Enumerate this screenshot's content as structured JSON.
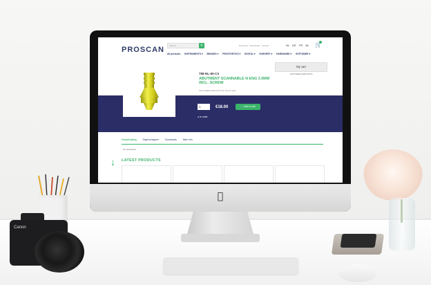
{
  "site": {
    "logo": "PROSCAN",
    "search_placeholder": "Search...",
    "top_links": "Prosceed · Downloads · Contact",
    "languages": [
      "NL",
      "DE",
      "FR",
      "NL"
    ],
    "nav": [
      "All products",
      "INSTRUMENTS ▾",
      "BRANDS ▾",
      "PROSTHETICS ▾",
      "DIGITAL ▾",
      "SURGERY ▾",
      "HARDWARE ▾",
      "SOFTWARE ▾"
    ],
    "cart_label": "My cart",
    "cart_note": "SOUTHERN IMPLANTS",
    "product": {
      "sku": "TIB-NL-60-C3",
      "title": "ABUTMENT SCANNABLE N ENG 3.0MM INCL. SCREW",
      "desc": "SOUTHERN IMPLANTS NL 60-C3 SCR",
      "qty": "1",
      "price": "€18.00",
      "add_label": "Add to cart",
      "stock": "In order"
    },
    "tabs": [
      "Omschrijving",
      "Eigenschappen",
      "Downloads",
      "Meer info"
    ],
    "tab_content": "No description",
    "latest_heading": "LATEST PRODUCTS"
  },
  "props": {
    "camera_brand": "Canon"
  }
}
